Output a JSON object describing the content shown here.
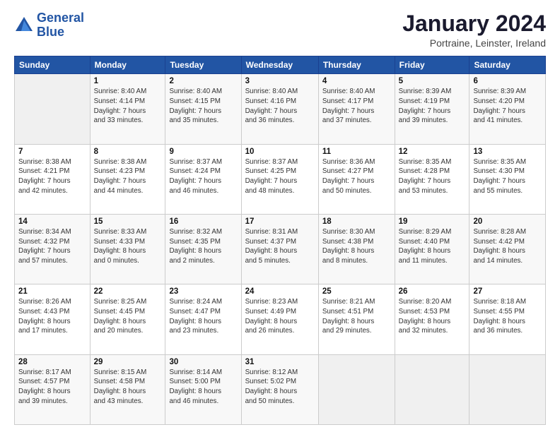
{
  "header": {
    "logo_line1": "General",
    "logo_line2": "Blue",
    "month": "January 2024",
    "location": "Portraine, Leinster, Ireland"
  },
  "weekdays": [
    "Sunday",
    "Monday",
    "Tuesday",
    "Wednesday",
    "Thursday",
    "Friday",
    "Saturday"
  ],
  "weeks": [
    [
      {
        "day": "",
        "info": ""
      },
      {
        "day": "1",
        "info": "Sunrise: 8:40 AM\nSunset: 4:14 PM\nDaylight: 7 hours\nand 33 minutes."
      },
      {
        "day": "2",
        "info": "Sunrise: 8:40 AM\nSunset: 4:15 PM\nDaylight: 7 hours\nand 35 minutes."
      },
      {
        "day": "3",
        "info": "Sunrise: 8:40 AM\nSunset: 4:16 PM\nDaylight: 7 hours\nand 36 minutes."
      },
      {
        "day": "4",
        "info": "Sunrise: 8:40 AM\nSunset: 4:17 PM\nDaylight: 7 hours\nand 37 minutes."
      },
      {
        "day": "5",
        "info": "Sunrise: 8:39 AM\nSunset: 4:19 PM\nDaylight: 7 hours\nand 39 minutes."
      },
      {
        "day": "6",
        "info": "Sunrise: 8:39 AM\nSunset: 4:20 PM\nDaylight: 7 hours\nand 41 minutes."
      }
    ],
    [
      {
        "day": "7",
        "info": "Sunrise: 8:38 AM\nSunset: 4:21 PM\nDaylight: 7 hours\nand 42 minutes."
      },
      {
        "day": "8",
        "info": "Sunrise: 8:38 AM\nSunset: 4:23 PM\nDaylight: 7 hours\nand 44 minutes."
      },
      {
        "day": "9",
        "info": "Sunrise: 8:37 AM\nSunset: 4:24 PM\nDaylight: 7 hours\nand 46 minutes."
      },
      {
        "day": "10",
        "info": "Sunrise: 8:37 AM\nSunset: 4:25 PM\nDaylight: 7 hours\nand 48 minutes."
      },
      {
        "day": "11",
        "info": "Sunrise: 8:36 AM\nSunset: 4:27 PM\nDaylight: 7 hours\nand 50 minutes."
      },
      {
        "day": "12",
        "info": "Sunrise: 8:35 AM\nSunset: 4:28 PM\nDaylight: 7 hours\nand 53 minutes."
      },
      {
        "day": "13",
        "info": "Sunrise: 8:35 AM\nSunset: 4:30 PM\nDaylight: 7 hours\nand 55 minutes."
      }
    ],
    [
      {
        "day": "14",
        "info": "Sunrise: 8:34 AM\nSunset: 4:32 PM\nDaylight: 7 hours\nand 57 minutes."
      },
      {
        "day": "15",
        "info": "Sunrise: 8:33 AM\nSunset: 4:33 PM\nDaylight: 8 hours\nand 0 minutes."
      },
      {
        "day": "16",
        "info": "Sunrise: 8:32 AM\nSunset: 4:35 PM\nDaylight: 8 hours\nand 2 minutes."
      },
      {
        "day": "17",
        "info": "Sunrise: 8:31 AM\nSunset: 4:37 PM\nDaylight: 8 hours\nand 5 minutes."
      },
      {
        "day": "18",
        "info": "Sunrise: 8:30 AM\nSunset: 4:38 PM\nDaylight: 8 hours\nand 8 minutes."
      },
      {
        "day": "19",
        "info": "Sunrise: 8:29 AM\nSunset: 4:40 PM\nDaylight: 8 hours\nand 11 minutes."
      },
      {
        "day": "20",
        "info": "Sunrise: 8:28 AM\nSunset: 4:42 PM\nDaylight: 8 hours\nand 14 minutes."
      }
    ],
    [
      {
        "day": "21",
        "info": "Sunrise: 8:26 AM\nSunset: 4:43 PM\nDaylight: 8 hours\nand 17 minutes."
      },
      {
        "day": "22",
        "info": "Sunrise: 8:25 AM\nSunset: 4:45 PM\nDaylight: 8 hours\nand 20 minutes."
      },
      {
        "day": "23",
        "info": "Sunrise: 8:24 AM\nSunset: 4:47 PM\nDaylight: 8 hours\nand 23 minutes."
      },
      {
        "day": "24",
        "info": "Sunrise: 8:23 AM\nSunset: 4:49 PM\nDaylight: 8 hours\nand 26 minutes."
      },
      {
        "day": "25",
        "info": "Sunrise: 8:21 AM\nSunset: 4:51 PM\nDaylight: 8 hours\nand 29 minutes."
      },
      {
        "day": "26",
        "info": "Sunrise: 8:20 AM\nSunset: 4:53 PM\nDaylight: 8 hours\nand 32 minutes."
      },
      {
        "day": "27",
        "info": "Sunrise: 8:18 AM\nSunset: 4:55 PM\nDaylight: 8 hours\nand 36 minutes."
      }
    ],
    [
      {
        "day": "28",
        "info": "Sunrise: 8:17 AM\nSunset: 4:57 PM\nDaylight: 8 hours\nand 39 minutes."
      },
      {
        "day": "29",
        "info": "Sunrise: 8:15 AM\nSunset: 4:58 PM\nDaylight: 8 hours\nand 43 minutes."
      },
      {
        "day": "30",
        "info": "Sunrise: 8:14 AM\nSunset: 5:00 PM\nDaylight: 8 hours\nand 46 minutes."
      },
      {
        "day": "31",
        "info": "Sunrise: 8:12 AM\nSunset: 5:02 PM\nDaylight: 8 hours\nand 50 minutes."
      },
      {
        "day": "",
        "info": ""
      },
      {
        "day": "",
        "info": ""
      },
      {
        "day": "",
        "info": ""
      }
    ]
  ]
}
